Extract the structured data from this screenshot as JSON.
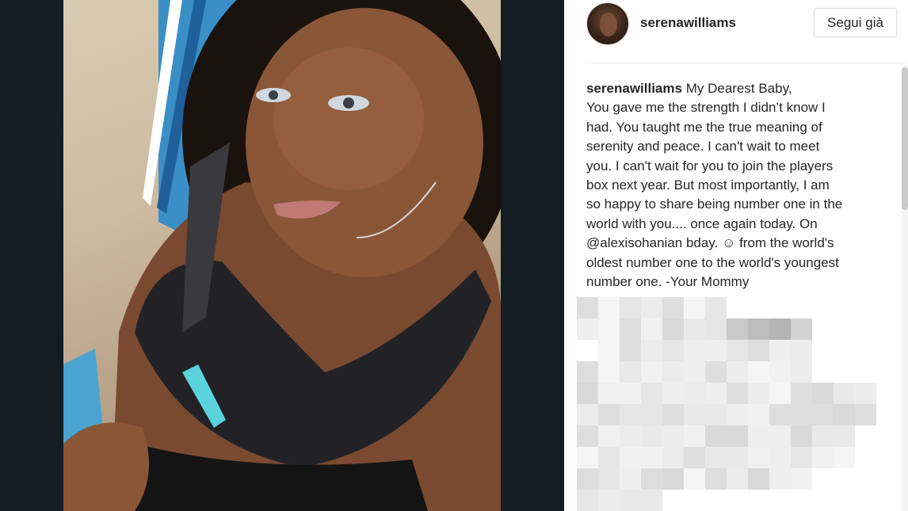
{
  "post": {
    "username": "serenawilliams",
    "follow_label": "Segui già",
    "caption_user": "serenawilliams",
    "caption_lines": [
      "My Dearest Baby,",
      "You gave me the strength I didn’t know I",
      "had. You taught me the true meaning of",
      "serenity and peace. I can't wait to meet",
      "you. I can't wait for you to join the players",
      "box next year. But most importantly, I am",
      "so happy to share being number one in the",
      "world with you.... once again today. On",
      "@alexisohanian bday. ☺ from the world's",
      "oldest number one to the world's youngest",
      "number one. -Your Mommy"
    ]
  },
  "colors": {
    "backdrop": "#141c24",
    "text": "#262626",
    "border": "#dbdbdb"
  }
}
